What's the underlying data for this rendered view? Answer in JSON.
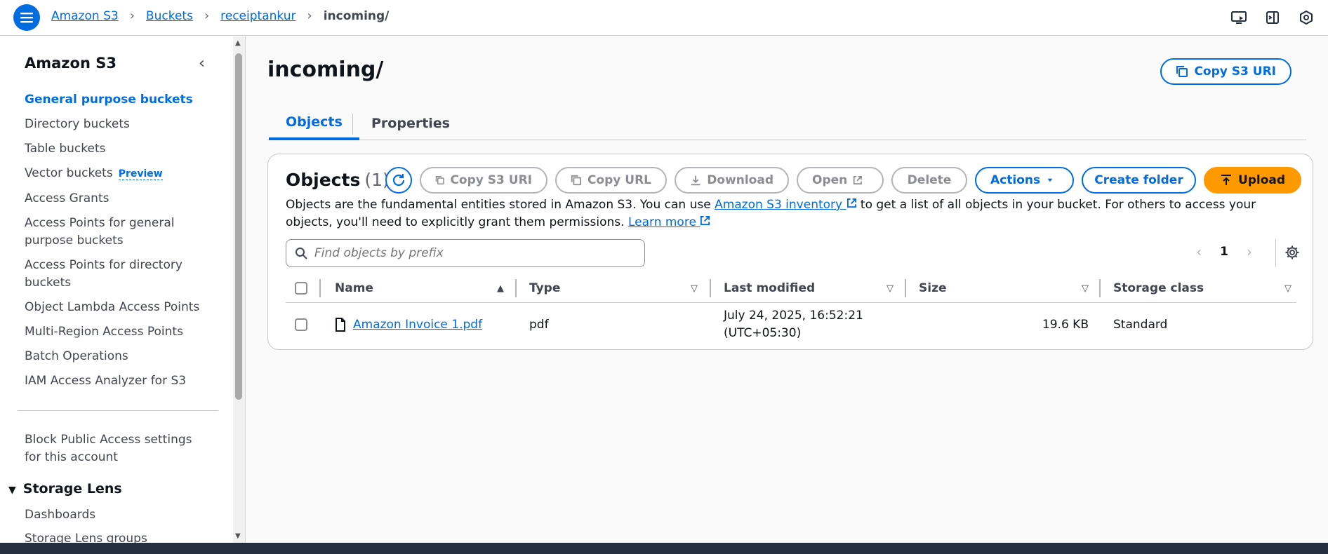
{
  "breadcrumb": {
    "items": [
      "Amazon S3",
      "Buckets",
      "receiptankur"
    ],
    "current": "incoming/"
  },
  "sidebar": {
    "title": "Amazon S3",
    "items": [
      {
        "label": "General purpose buckets",
        "active": true
      },
      {
        "label": "Directory buckets"
      },
      {
        "label": "Table buckets"
      },
      {
        "label": "Vector buckets",
        "badge": "Preview"
      },
      {
        "label": "Access Grants"
      },
      {
        "label": "Access Points for general purpose buckets"
      },
      {
        "label": "Access Points for directory buckets"
      },
      {
        "label": "Object Lambda Access Points"
      },
      {
        "label": "Multi-Region Access Points"
      },
      {
        "label": "Batch Operations"
      },
      {
        "label": "IAM Access Analyzer for S3"
      }
    ],
    "block_public_access": "Block Public Access settings for this account",
    "storage_lens": "Storage Lens",
    "dashboards": "Dashboards",
    "storage_lens_groups": "Storage Lens groups"
  },
  "main": {
    "title": "incoming/",
    "copy_s3_uri": "Copy S3 URI",
    "tabs": [
      "Objects",
      "Properties"
    ]
  },
  "objects_panel": {
    "title": "Objects",
    "count": "(1)",
    "buttons": {
      "copy_s3_uri": "Copy S3 URI",
      "copy_url": "Copy URL",
      "download": "Download",
      "open": "Open",
      "delete": "Delete",
      "actions": "Actions",
      "create_folder": "Create folder",
      "upload": "Upload"
    },
    "description_1": "Objects are the fundamental entities stored in Amazon S3. You can use ",
    "inventory_link": "Amazon S3 inventory",
    "description_2": " to get a list of all objects in your bucket. For others to access your objects, you'll need to explicitly grant them permissions. ",
    "learn_more": "Learn more",
    "search_placeholder": "Find objects by prefix",
    "page_number": "1",
    "columns": [
      "Name",
      "Type",
      "Last modified",
      "Size",
      "Storage class"
    ],
    "rows": [
      {
        "name": "Amazon Invoice 1.pdf",
        "type": "pdf",
        "last_modified_1": "July 24, 2025, 16:52:21",
        "last_modified_2": "(UTC+05:30)",
        "size": "19.6 KB",
        "storage_class": "Standard"
      }
    ]
  },
  "colors": {
    "accent": "#006ce0",
    "upload": "#ff9900"
  }
}
